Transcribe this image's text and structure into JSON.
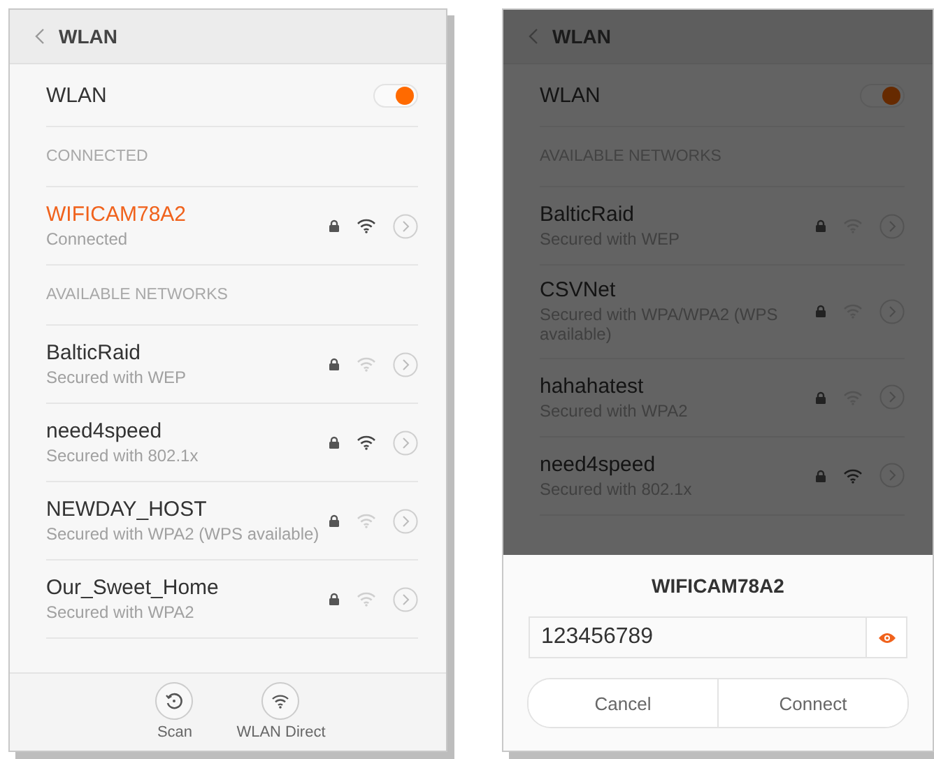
{
  "left_screen": {
    "header": {
      "title": "WLAN"
    },
    "wlan": {
      "label": "WLAN",
      "on": true
    },
    "sections": [
      {
        "title": "CONNECTED",
        "networks": [
          {
            "name": "WIFICAM78A2",
            "status": "Connected",
            "connected": true,
            "locked": true,
            "strong": true
          }
        ]
      },
      {
        "title": "AVAILABLE NETWORKS",
        "networks": [
          {
            "name": "BalticRaid",
            "status": "Secured with WEP",
            "connected": false,
            "locked": true,
            "strong": false
          },
          {
            "name": "need4speed",
            "status": "Secured with 802.1x",
            "connected": false,
            "locked": true,
            "strong": true
          },
          {
            "name": "NEWDAY_HOST",
            "status": "Secured with WPA2 (WPS available)",
            "connected": false,
            "locked": true,
            "strong": false
          },
          {
            "name": "Our_Sweet_Home",
            "status": "Secured with WPA2",
            "connected": false,
            "locked": true,
            "strong": false
          }
        ]
      }
    ],
    "bottom_actions": [
      {
        "label": "Scan",
        "kind": "scan"
      },
      {
        "label": "WLAN Direct",
        "kind": "direct"
      }
    ]
  },
  "right_screen": {
    "header": {
      "title": "WLAN"
    },
    "wlan": {
      "label": "WLAN",
      "on": true
    },
    "sections": [
      {
        "title": "AVAILABLE NETWORKS",
        "networks": [
          {
            "name": "BalticRaid",
            "status": "Secured with WEP",
            "connected": false,
            "locked": true,
            "strong": false
          },
          {
            "name": "CSVNet",
            "status": "Secured with WPA/WPA2 (WPS available)",
            "connected": false,
            "locked": true,
            "strong": false
          },
          {
            "name": "hahahatest",
            "status": "Secured with WPA2",
            "connected": false,
            "locked": true,
            "strong": false
          },
          {
            "name": "need4speed",
            "status": "Secured with 802.1x",
            "connected": false,
            "locked": true,
            "strong": true
          }
        ]
      }
    ],
    "dialog": {
      "title": "WIFICAM78A2",
      "password": "123456789",
      "show_password": true,
      "buttons": [
        {
          "label": "Cancel"
        },
        {
          "label": "Connect"
        }
      ]
    }
  }
}
